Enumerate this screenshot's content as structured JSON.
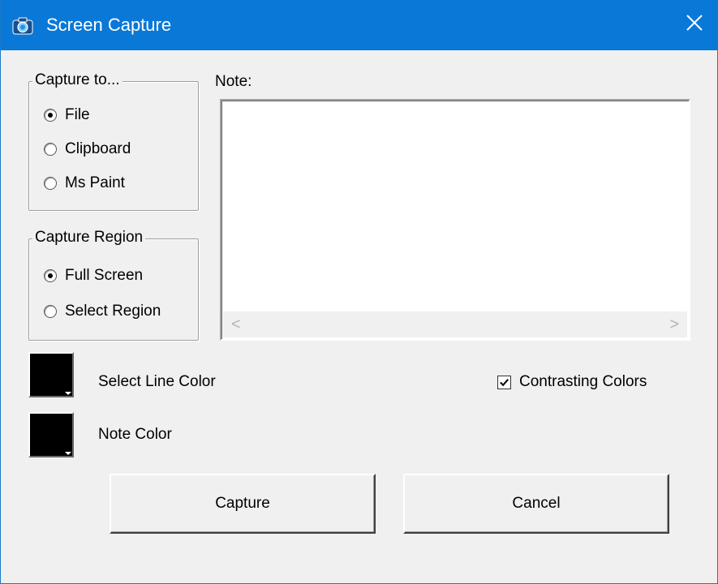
{
  "window": {
    "title": "Screen Capture",
    "title_color": "#0a78d7"
  },
  "icons": {
    "app": "camera-icon",
    "close": "close-icon"
  },
  "capture_to": {
    "legend": "Capture to...",
    "options": [
      {
        "label": "File",
        "checked": true
      },
      {
        "label": "Clipboard",
        "checked": false
      },
      {
        "label": "Ms Paint",
        "checked": false
      }
    ]
  },
  "capture_region": {
    "legend": "Capture Region",
    "options": [
      {
        "label": "Full Screen",
        "checked": true
      },
      {
        "label": "Select Region",
        "checked": false
      }
    ]
  },
  "note": {
    "label": "Note:",
    "value": "",
    "scroll_left": "<",
    "scroll_right": ">"
  },
  "line_color": {
    "label": "Select Line Color",
    "color": "#000000"
  },
  "note_color": {
    "label": "Note Color",
    "color": "#000000"
  },
  "contrasting": {
    "label": "Contrasting Colors",
    "checked": true
  },
  "buttons": {
    "capture": "Capture",
    "cancel": "Cancel"
  }
}
